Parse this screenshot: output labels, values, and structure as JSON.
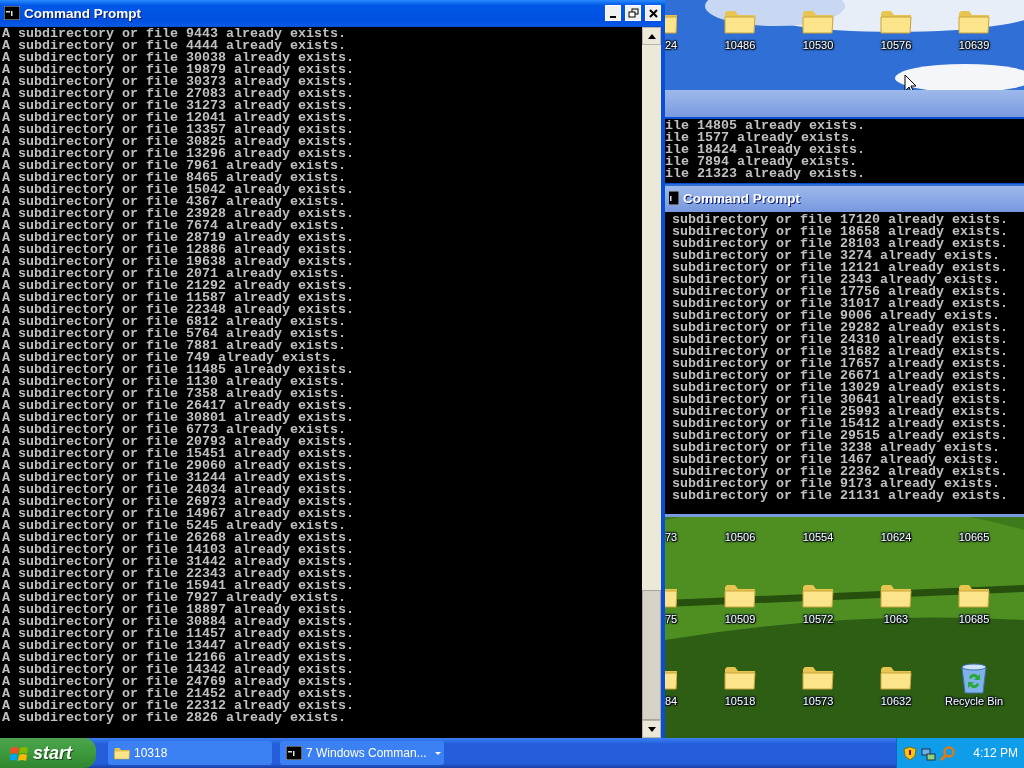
{
  "main_window": {
    "title": "Command Prompt",
    "lines": [
      "A subdirectory or file 9443 already exists.",
      "A subdirectory or file 4444 already exists.",
      "A subdirectory or file 30038 already exists.",
      "A subdirectory or file 19879 already exists.",
      "A subdirectory or file 30373 already exists.",
      "A subdirectory or file 27083 already exists.",
      "A subdirectory or file 31273 already exists.",
      "A subdirectory or file 12041 already exists.",
      "A subdirectory or file 13357 already exists.",
      "A subdirectory or file 30825 already exists.",
      "A subdirectory or file 13296 already exists.",
      "A subdirectory or file 7961 already exists.",
      "A subdirectory or file 8465 already exists.",
      "A subdirectory or file 15042 already exists.",
      "A subdirectory or file 4367 already exists.",
      "A subdirectory or file 23928 already exists.",
      "A subdirectory or file 7674 already exists.",
      "A subdirectory or file 28719 already exists.",
      "A subdirectory or file 12886 already exists.",
      "A subdirectory or file 19638 already exists.",
      "A subdirectory or file 2071 already exists.",
      "A subdirectory or file 21292 already exists.",
      "A subdirectory or file 11587 already exists.",
      "A subdirectory or file 22348 already exists.",
      "A subdirectory or file 6812 already exists.",
      "A subdirectory or file 5764 already exists.",
      "A subdirectory or file 7881 already exists.",
      "A subdirectory or file 749 already exists.",
      "A subdirectory or file 11485 already exists.",
      "A subdirectory or file 1130 already exists.",
      "A subdirectory or file 7358 already exists.",
      "A subdirectory or file 26417 already exists.",
      "A subdirectory or file 30801 already exists.",
      "A subdirectory or file 6773 already exists.",
      "A subdirectory or file 20793 already exists.",
      "A subdirectory or file 15451 already exists.",
      "A subdirectory or file 29060 already exists.",
      "A subdirectory or file 31244 already exists.",
      "A subdirectory or file 24034 already exists.",
      "A subdirectory or file 26973 already exists.",
      "A subdirectory or file 14967 already exists.",
      "A subdirectory or file 5245 already exists.",
      "A subdirectory or file 26268 already exists.",
      "A subdirectory or file 14103 already exists.",
      "A subdirectory or file 31442 already exists.",
      "A subdirectory or file 22343 already exists.",
      "A subdirectory or file 15941 already exists.",
      "A subdirectory or file 7927 already exists.",
      "A subdirectory or file 18897 already exists.",
      "A subdirectory or file 30884 already exists.",
      "A subdirectory or file 11457 already exists.",
      "A subdirectory or file 13447 already exists.",
      "A subdirectory or file 12166 already exists.",
      "A subdirectory or file 14342 already exists.",
      "A subdirectory or file 24769 already exists.",
      "A subdirectory or file 21452 already exists.",
      "A subdirectory or file 22312 already exists.",
      "A subdirectory or file 2826 already exists."
    ]
  },
  "background_window": {
    "lines": [
      "ile 14805 already exists.",
      "ile 1577 already exists.",
      "ile 18424 already exists.",
      "ile 7894 already exists.",
      "ile 21323 already exists."
    ]
  },
  "front_window": {
    "title": "Command Prompt",
    "lines": [
      "subdirectory or file 17120 already exists.",
      "subdirectory or file 18658 already exists.",
      "subdirectory or file 28103 already exists.",
      "subdirectory or file 3274 already exists.",
      "subdirectory or file 12121 already exists.",
      "subdirectory or file 2343 already exists.",
      "subdirectory or file 17756 already exists.",
      "subdirectory or file 31017 already exists.",
      "subdirectory or file 9006 already exists.",
      "subdirectory or file 29282 already exists.",
      "subdirectory or file 24310 already exists.",
      "subdirectory or file 31682 already exists.",
      "subdirectory or file 17657 already exists.",
      "subdirectory or file 26671 already exists.",
      "subdirectory or file 13029 already exists.",
      "subdirectory or file 30641 already exists.",
      "subdirectory or file 25993 already exists.",
      "subdirectory or file 15412 already exists.",
      "subdirectory or file 29515 already exists.",
      "subdirectory or file 3238 already exists.",
      "subdirectory or file 1467 already exists.",
      "subdirectory or file 22362 already exists.",
      "subdirectory or file 9173 already exists.",
      "subdirectory or file 21131 already exists."
    ]
  },
  "desktop_icons": [
    [
      {
        "label": "24",
        "kind": "folder",
        "cut": true
      },
      {
        "label": "10486",
        "kind": "folder",
        "cut": false
      },
      {
        "label": "10530",
        "kind": "folder",
        "cut": false
      },
      {
        "label": "10576",
        "kind": "folder",
        "cut": false
      },
      {
        "label": "10639",
        "kind": "folder",
        "cut": false
      }
    ],
    [
      {
        "label": "73",
        "kind": "label_only",
        "cut": true
      },
      {
        "label": "10506",
        "kind": "label_only",
        "cut": false
      },
      {
        "label": "10554",
        "kind": "label_only",
        "cut": false
      },
      {
        "label": "10624",
        "kind": "label_only",
        "cut": false
      },
      {
        "label": "10665",
        "kind": "label_only",
        "cut": false
      }
    ],
    [
      {
        "label": "75",
        "kind": "folder",
        "cut": true
      },
      {
        "label": "10509",
        "kind": "folder",
        "cut": false
      },
      {
        "label": "10572",
        "kind": "folder",
        "cut": false
      },
      {
        "label": "1063",
        "kind": "folder",
        "cut": false
      },
      {
        "label": "10685",
        "kind": "folder",
        "cut": false
      }
    ],
    [
      {
        "label": "84",
        "kind": "folder",
        "cut": true
      },
      {
        "label": "10518",
        "kind": "folder",
        "cut": false
      },
      {
        "label": "10573",
        "kind": "folder",
        "cut": false
      },
      {
        "label": "10632",
        "kind": "folder",
        "cut": false
      },
      {
        "label": "Recycle Bin",
        "kind": "recycle_bin",
        "cut": false
      }
    ]
  ],
  "taskbar": {
    "start": "start",
    "tasks": [
      {
        "label": "10318",
        "kind": "folder",
        "caret": false
      },
      {
        "label": "7 Windows Comman...",
        "kind": "console",
        "caret": true
      }
    ],
    "clock": "4:12 PM"
  }
}
